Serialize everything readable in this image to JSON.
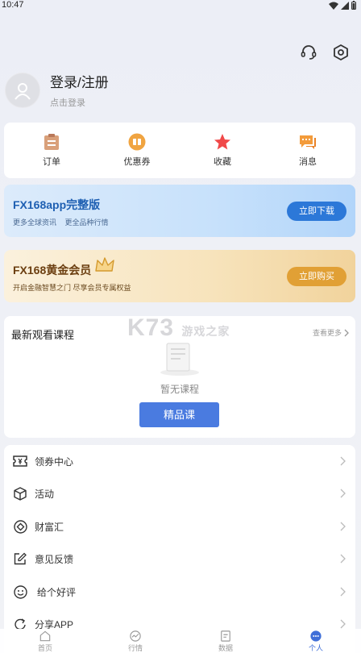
{
  "status_bar": {
    "time": "10:47"
  },
  "profile": {
    "title": "登录/注册",
    "subtitle": "点击登录"
  },
  "quick_actions": [
    {
      "label": "订单",
      "icon": "order-clipboard-icon"
    },
    {
      "label": "优惠券",
      "icon": "coupon-icon"
    },
    {
      "label": "收藏",
      "icon": "star-icon"
    },
    {
      "label": "消息",
      "icon": "message-icon"
    }
  ],
  "app_banner": {
    "title": "FX168app完整版",
    "sub1": "更多全球资讯",
    "sub2": "更全品种行情",
    "button": "立即下载"
  },
  "vip_banner": {
    "title": "FX168黄金会员",
    "sub": "开启金融智慧之门 尽享会员专属权益",
    "button": "立即购买"
  },
  "courses": {
    "title": "最新观看课程",
    "more": "查看更多",
    "empty": "暂无课程",
    "button": "精品课"
  },
  "watermark": {
    "brand": "K73",
    "text": "游戏之家"
  },
  "menu": [
    {
      "label": "领券中心",
      "icon": "coupon-ticket-icon"
    },
    {
      "label": "活动",
      "icon": "cube-icon"
    },
    {
      "label": "财富汇",
      "icon": "diamond-icon"
    },
    {
      "label": "意见反馈",
      "icon": "edit-feedback-icon"
    },
    {
      "label": "给个好评",
      "icon": "smile-icon"
    },
    {
      "label": "分享APP",
      "icon": "share-icon"
    }
  ],
  "tabs": [
    {
      "label": "首页",
      "icon": "home-icon"
    },
    {
      "label": "行情",
      "icon": "market-chart-icon"
    },
    {
      "label": "数据",
      "icon": "data-document-icon"
    },
    {
      "label": "个人",
      "icon": "profile-dots-icon",
      "active": true
    }
  ],
  "colors": {
    "accent": "#4a7be0",
    "gold": "#e1a035",
    "star": "#f04848"
  }
}
